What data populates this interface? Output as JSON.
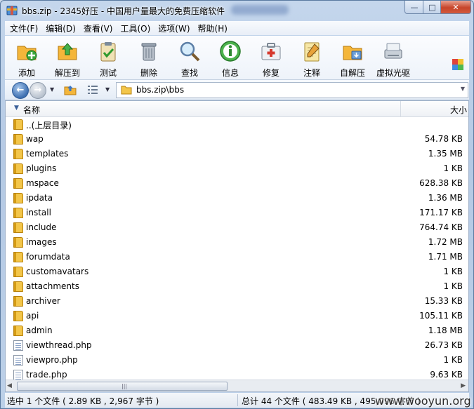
{
  "window": {
    "title": "bbs.zip - 2345好压 - 中国用户量最大的免费压缩软件",
    "minimize_glyph": "—",
    "maximize_glyph": "□",
    "close_glyph": "✕"
  },
  "menu": [
    {
      "label": "文件(F)"
    },
    {
      "label": "编辑(D)"
    },
    {
      "label": "查看(V)"
    },
    {
      "label": "工具(O)"
    },
    {
      "label": "选项(W)"
    },
    {
      "label": "帮助(H)"
    }
  ],
  "toolbar": [
    {
      "label": "添加",
      "icon": "add-archive-icon"
    },
    {
      "label": "解压到",
      "icon": "extract-to-icon"
    },
    {
      "label": "测试",
      "icon": "test-clipboard-icon"
    },
    {
      "label": "删除",
      "icon": "trash-can-icon"
    },
    {
      "label": "查找",
      "icon": "magnifier-icon"
    },
    {
      "label": "信息",
      "icon": "info-icon"
    },
    {
      "label": "修复",
      "icon": "first-aid-kit-icon"
    },
    {
      "label": "注释",
      "icon": "notepad-icon"
    },
    {
      "label": "自解压",
      "icon": "self-extract-icon"
    },
    {
      "label": "虚拟光驱",
      "icon": "virtual-drive-icon"
    }
  ],
  "address": {
    "path": "bbs.zip\\bbs"
  },
  "columns": {
    "name": "名称",
    "size": "大小"
  },
  "files": [
    {
      "name": "..(上层目录)",
      "size": "",
      "type": "folder"
    },
    {
      "name": "wap",
      "size": "54.78 KB",
      "type": "folder"
    },
    {
      "name": "templates",
      "size": "1.35 MB",
      "type": "folder"
    },
    {
      "name": "plugins",
      "size": "1 KB",
      "type": "folder"
    },
    {
      "name": "mspace",
      "size": "628.38 KB",
      "type": "folder"
    },
    {
      "name": "ipdata",
      "size": "1.36 MB",
      "type": "folder"
    },
    {
      "name": "install",
      "size": "171.17 KB",
      "type": "folder"
    },
    {
      "name": "include",
      "size": "764.74 KB",
      "type": "folder"
    },
    {
      "name": "images",
      "size": "1.72 MB",
      "type": "folder"
    },
    {
      "name": "forumdata",
      "size": "1.71 MB",
      "type": "folder"
    },
    {
      "name": "customavatars",
      "size": "1 KB",
      "type": "folder"
    },
    {
      "name": "attachments",
      "size": "1 KB",
      "type": "folder"
    },
    {
      "name": "archiver",
      "size": "15.33 KB",
      "type": "folder"
    },
    {
      "name": "api",
      "size": "105.11 KB",
      "type": "folder"
    },
    {
      "name": "admin",
      "size": "1.18 MB",
      "type": "folder"
    },
    {
      "name": "viewthread.php",
      "size": "26.73 KB",
      "type": "php"
    },
    {
      "name": "viewpro.php",
      "size": "1 KB",
      "type": "php"
    },
    {
      "name": "trade.php",
      "size": "9.63 KB",
      "type": "php"
    }
  ],
  "status": {
    "selected": "选中 1 个文件 ( 2.89 KB , 2,967 字节 )",
    "total": "总计 44 个文件 ( 483.49 KB , 495,096 字节 )"
  },
  "watermark": "www.wooyun.org",
  "colors": {
    "folder": "#f3c64a",
    "frame": "#b4c9e4",
    "close": "#c7452a"
  }
}
